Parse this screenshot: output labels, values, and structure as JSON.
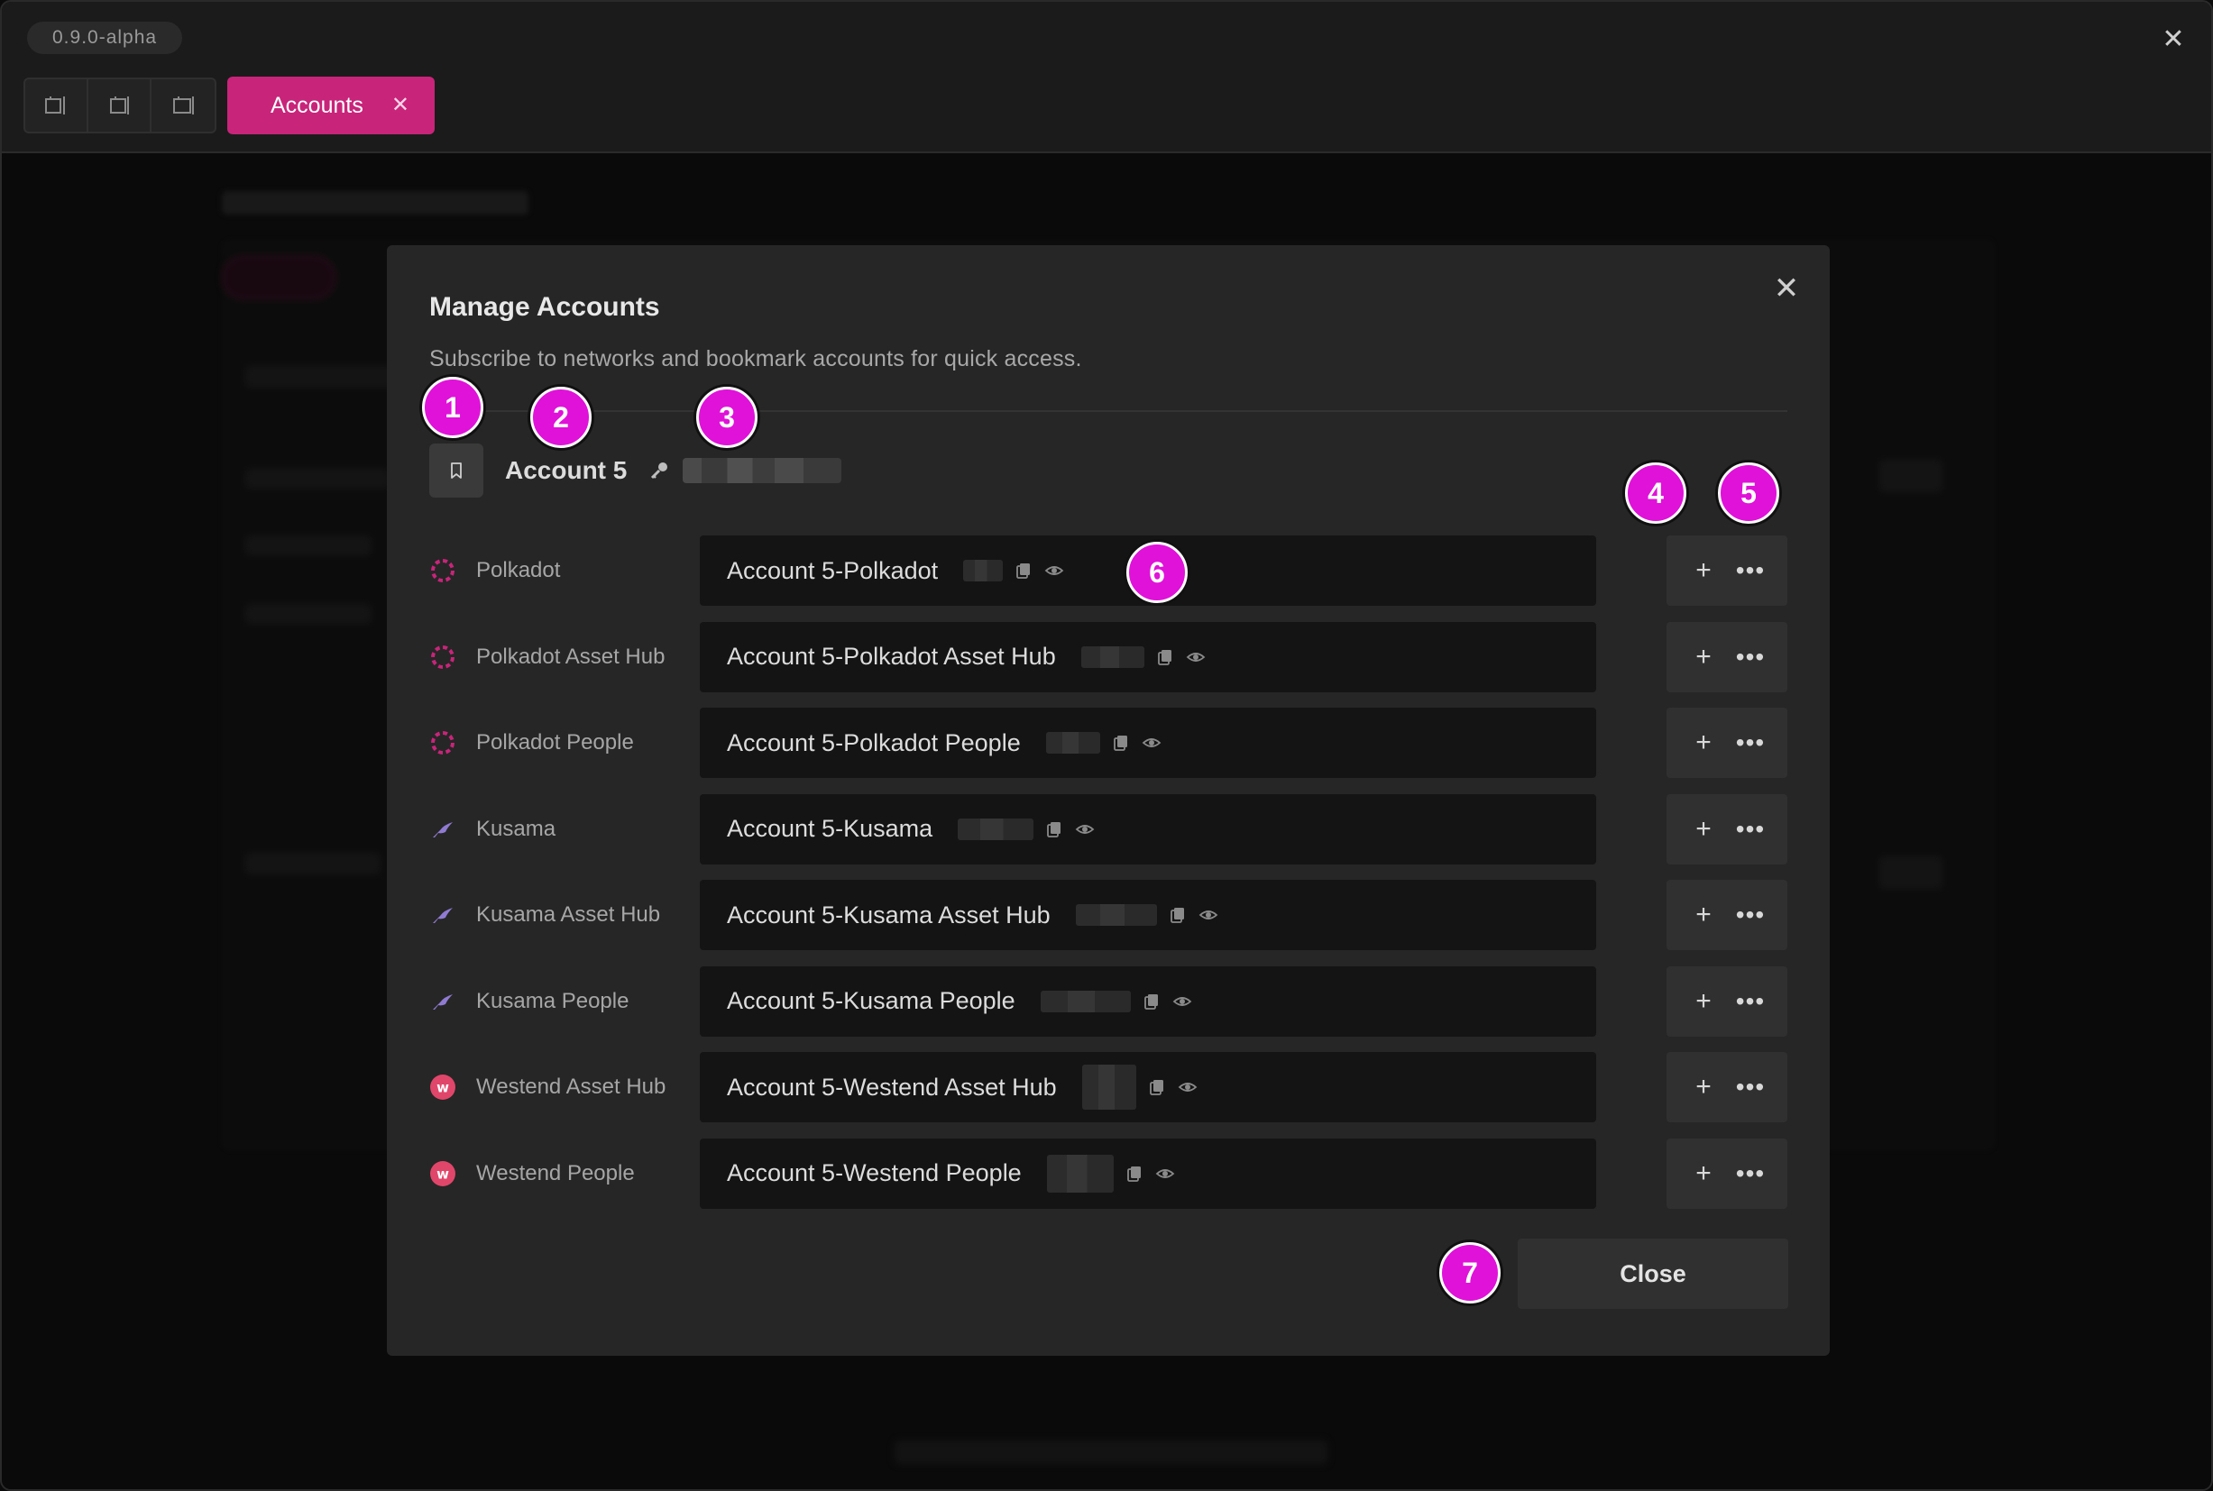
{
  "window": {
    "version": "0.9.0-alpha",
    "close_glyph": "✕"
  },
  "toolbar": {
    "layout_buttons": [
      "layout-left-icon",
      "layout-center-icon",
      "layout-right-icon"
    ],
    "active_tab": {
      "label": "Accounts",
      "close_glyph": "✕"
    }
  },
  "modal": {
    "title": "Manage Accounts",
    "subtitle": "Subscribe to networks and bookmark accounts for quick access.",
    "close_glyph": "✕",
    "account": {
      "name": "Account 5"
    },
    "add_glyph": "+",
    "more_glyph": "•••",
    "rows": [
      {
        "network": "Polkadot",
        "icon": "polkadot-icon",
        "account_label": "Account 5-Polkadot"
      },
      {
        "network": "Polkadot Asset Hub",
        "icon": "polkadot-icon",
        "account_label": "Account 5-Polkadot Asset Hub"
      },
      {
        "network": "Polkadot People",
        "icon": "polkadot-icon",
        "account_label": "Account 5-Polkadot People"
      },
      {
        "network": "Kusama",
        "icon": "kusama-icon",
        "account_label": "Account 5-Kusama"
      },
      {
        "network": "Kusama Asset Hub",
        "icon": "kusama-icon",
        "account_label": "Account 5-Kusama Asset Hub"
      },
      {
        "network": "Kusama People",
        "icon": "kusama-icon",
        "account_label": "Account 5-Kusama People"
      },
      {
        "network": "Westend Asset Hub",
        "icon": "westend-icon",
        "account_label": "Account 5-Westend Asset Hub"
      },
      {
        "network": "Westend People",
        "icon": "westend-icon",
        "account_label": "Account 5-Westend People"
      }
    ],
    "close_label": "Close"
  },
  "markers": [
    "1",
    "2",
    "3",
    "4",
    "5",
    "6",
    "7"
  ],
  "colors": {
    "accent": "#c7247a",
    "marker": "#e011d8",
    "polkadot": "#c7247a",
    "kusama": "#8f7bd1",
    "westend": "#e0456a"
  }
}
